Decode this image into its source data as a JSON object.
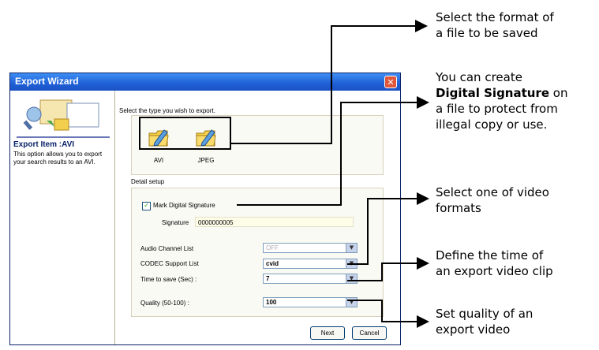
{
  "dialog": {
    "title": "Export Wizard",
    "close_glyph": "✕",
    "export_item_title": "Export Item :AVI",
    "export_item_desc": "This option allows you to export your search results to an AVI.",
    "select_type_label": "Select the type you wish to export.",
    "formats": [
      {
        "label": "AVI",
        "icon": "folder-pencil-icon"
      },
      {
        "label": "JPEG",
        "icon": "folder-pencil-icon"
      }
    ],
    "detail_setup_label": "Detail setup",
    "mark_signature_label": "Mark Digital Signature",
    "mark_signature_checked": true,
    "signature_label": "Signature",
    "signature_value": "0000000005",
    "audio_label": "Audio Channel List",
    "audio_value": "OFF",
    "codec_label": "CODEC Support List",
    "codec_value": "cvid",
    "time_label": "Time to save (Sec) :",
    "time_value": "7",
    "quality_label": "Quality (50-100) :",
    "quality_value": "100",
    "next_button": "Next",
    "cancel_button": "Cancel",
    "check_glyph": "✓",
    "dropdown_glyph": "▼"
  },
  "callouts": {
    "format": [
      "Select the format of",
      "a file to be saved"
    ],
    "signature_line1": "You can create",
    "signature_bold": "Digital Signature",
    "signature_after_bold": " on",
    "signature_line3": "a file to protect from",
    "signature_line4": "illegal copy or use.",
    "video_format": [
      "Select one of video",
      "formats"
    ],
    "time": [
      "Define the time of",
      "an export video clip"
    ],
    "quality": [
      "Set quality of an",
      "export video"
    ]
  }
}
